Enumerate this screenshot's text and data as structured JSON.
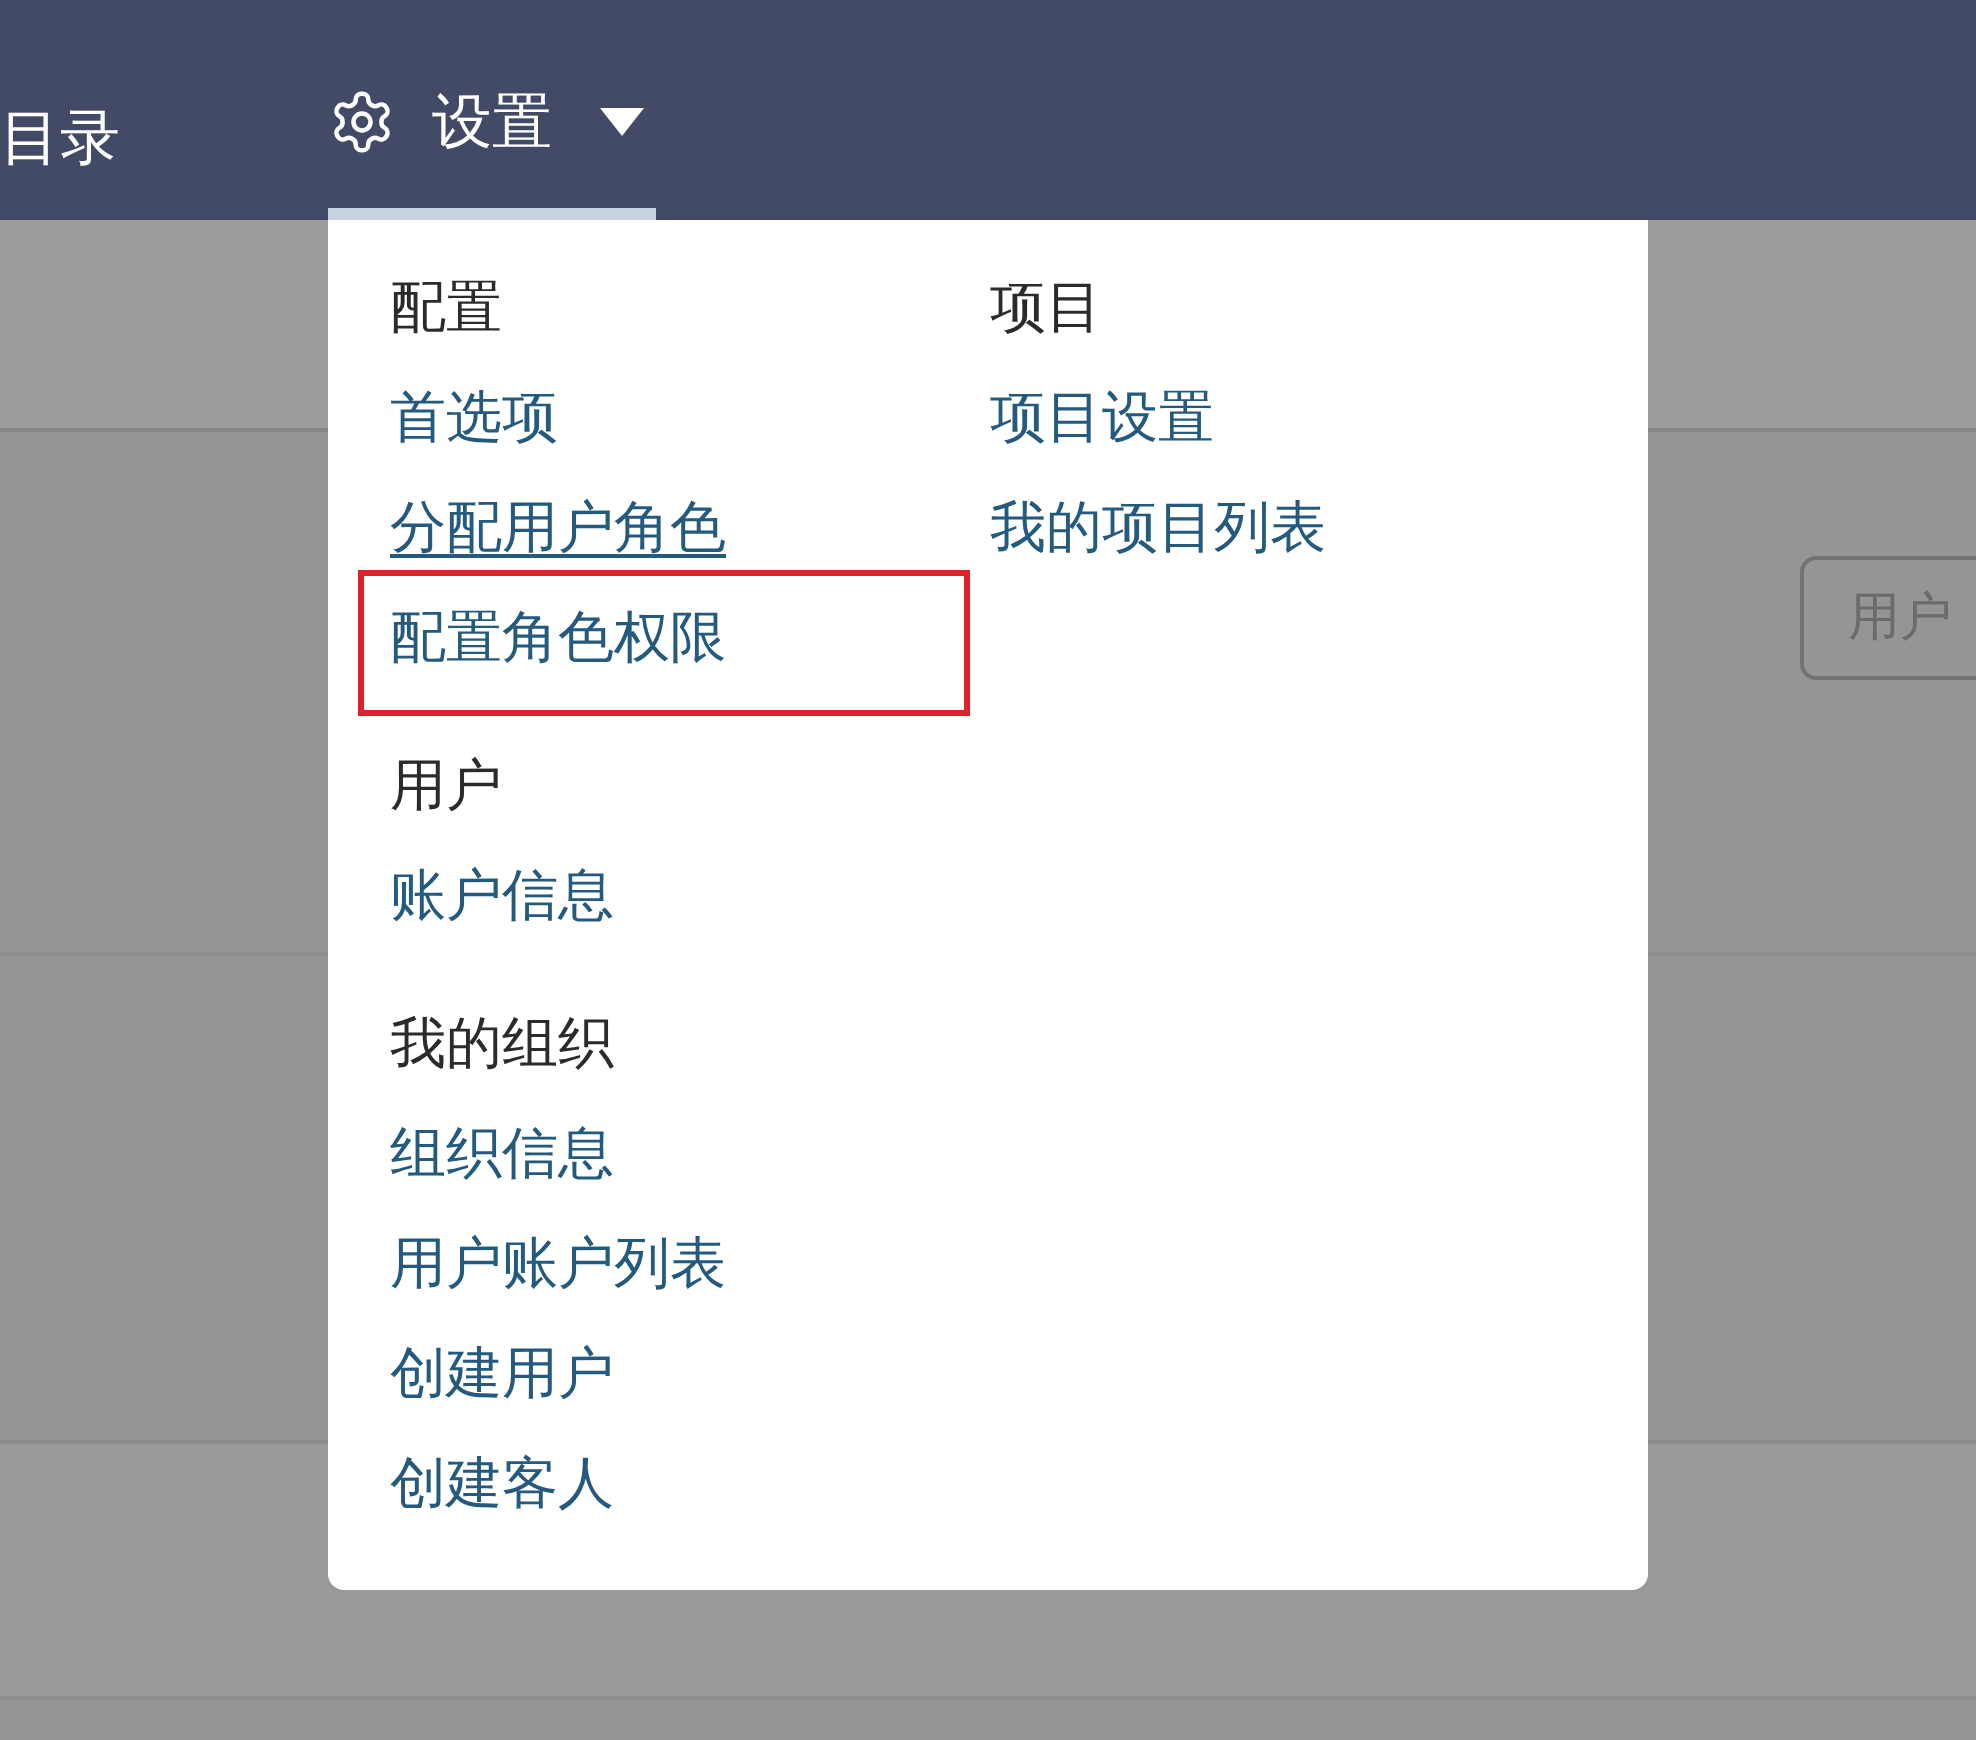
{
  "nav": {
    "left_item": "目录",
    "settings": {
      "label": "设置",
      "expanded": true
    }
  },
  "menu": {
    "columns": [
      {
        "sections": [
          {
            "heading": "配置",
            "items": [
              {
                "label": "首选项",
                "hovered": false,
                "highlighted": false
              },
              {
                "label": "分配用户角色",
                "hovered": true,
                "highlighted": false
              },
              {
                "label": "配置角色权限",
                "hovered": false,
                "highlighted": true
              }
            ]
          },
          {
            "heading": "用户",
            "items": [
              {
                "label": "账户信息",
                "hovered": false,
                "highlighted": false
              }
            ]
          },
          {
            "heading": "我的组织",
            "items": [
              {
                "label": "组织信息",
                "hovered": false,
                "highlighted": false
              },
              {
                "label": "用户账户列表",
                "hovered": false,
                "highlighted": false
              },
              {
                "label": "创建用户",
                "hovered": false,
                "highlighted": false
              },
              {
                "label": "创建客人",
                "hovered": false,
                "highlighted": false
              }
            ]
          }
        ]
      },
      {
        "sections": [
          {
            "heading": "项目",
            "items": [
              {
                "label": "项目设置",
                "hovered": false,
                "highlighted": false
              },
              {
                "label": "我的项目列表",
                "hovered": false,
                "highlighted": false
              }
            ]
          }
        ]
      }
    ]
  },
  "background": {
    "button": "用户"
  }
}
